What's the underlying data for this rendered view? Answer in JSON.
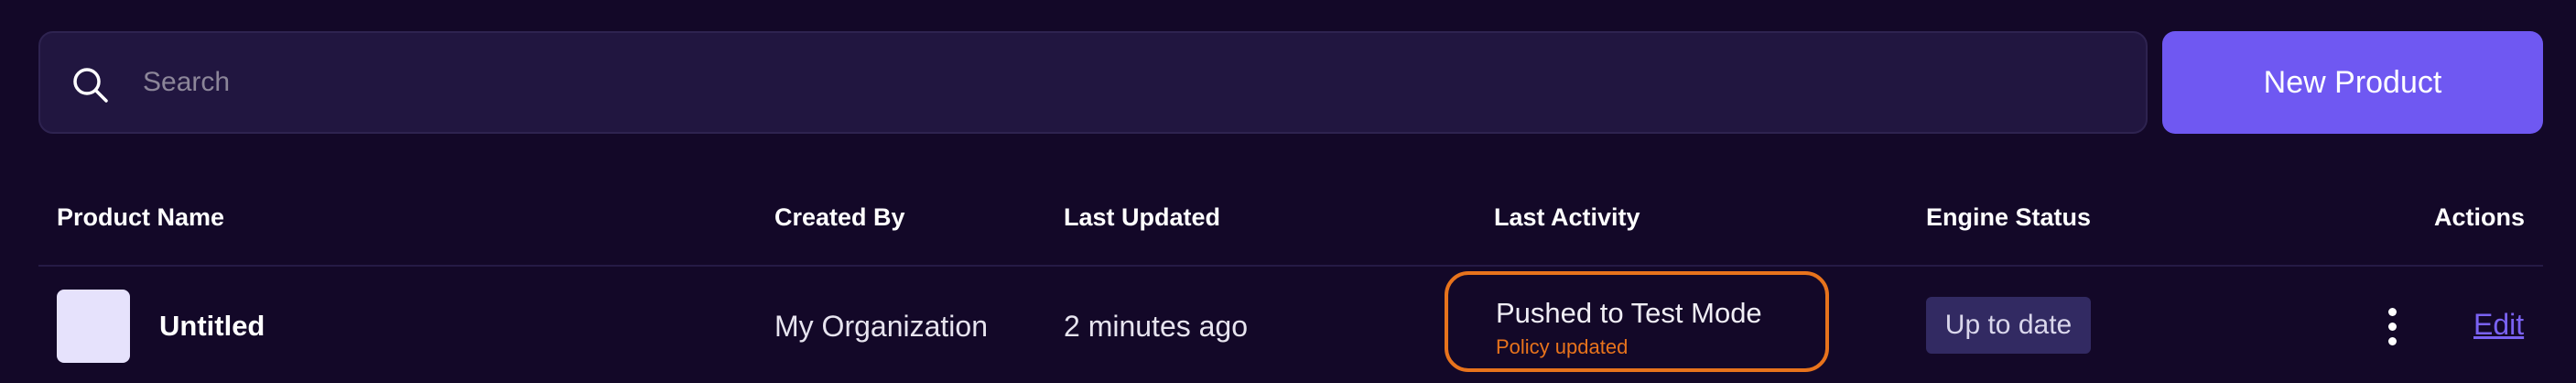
{
  "search": {
    "placeholder": "Search",
    "value": ""
  },
  "toolbar": {
    "new_product_label": "New Product"
  },
  "table": {
    "headers": {
      "product_name": "Product Name",
      "created_by": "Created By",
      "last_updated": "Last Updated",
      "last_activity": "Last Activity",
      "engine_status": "Engine Status",
      "actions": "Actions"
    },
    "rows": [
      {
        "product_name": "Untitled",
        "created_by": "My Organization",
        "last_updated": "2 minutes ago",
        "last_activity": {
          "title": "Pushed to Test Mode",
          "subtitle": "Policy updated"
        },
        "engine_status": "Up to date",
        "edit_label": "Edit"
      }
    ]
  },
  "icons": {
    "search": "search-icon",
    "more": "more-vertical-icon"
  },
  "colors": {
    "background": "#130828",
    "primary": "#6f58f2",
    "activity_highlight": "#e8731c",
    "status_badge": "#322a62",
    "link": "#7a62f2"
  }
}
